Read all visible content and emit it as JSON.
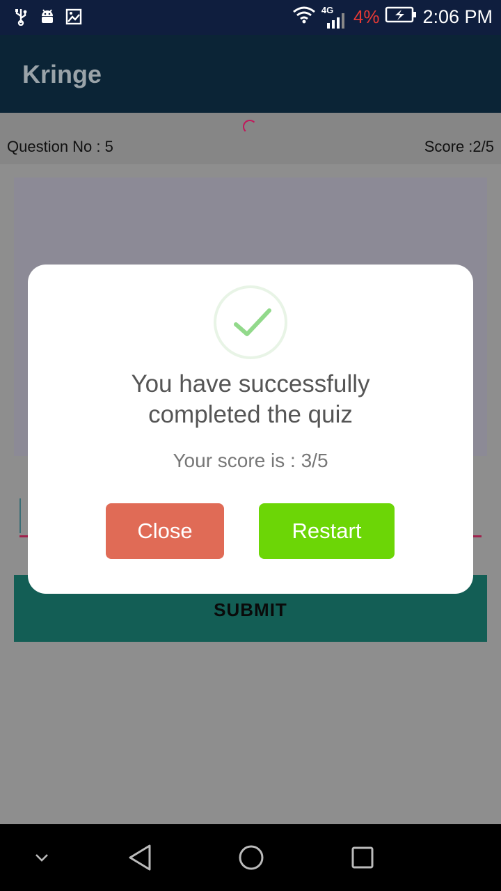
{
  "status_bar": {
    "network": "4G",
    "battery_percent": "4%",
    "time": "2:06 PM",
    "battery_color": "#e53935"
  },
  "app": {
    "title": "Kringe"
  },
  "quiz": {
    "question_no": "Question No : 5",
    "score": "Score :2/5",
    "submit_label": "SUBMIT"
  },
  "dialog": {
    "icon": "checkmark-icon",
    "title_line1": "You have successfully",
    "title_line2": "completed the quiz",
    "score_text": "Your score is : 3/5",
    "close_label": "Close",
    "restart_label": "Restart",
    "close_color": "#e06b56",
    "restart_color": "#6cd606"
  },
  "nav_bar": {
    "icons": [
      "chevron-down-icon",
      "back-icon",
      "home-icon",
      "recents-icon"
    ]
  }
}
